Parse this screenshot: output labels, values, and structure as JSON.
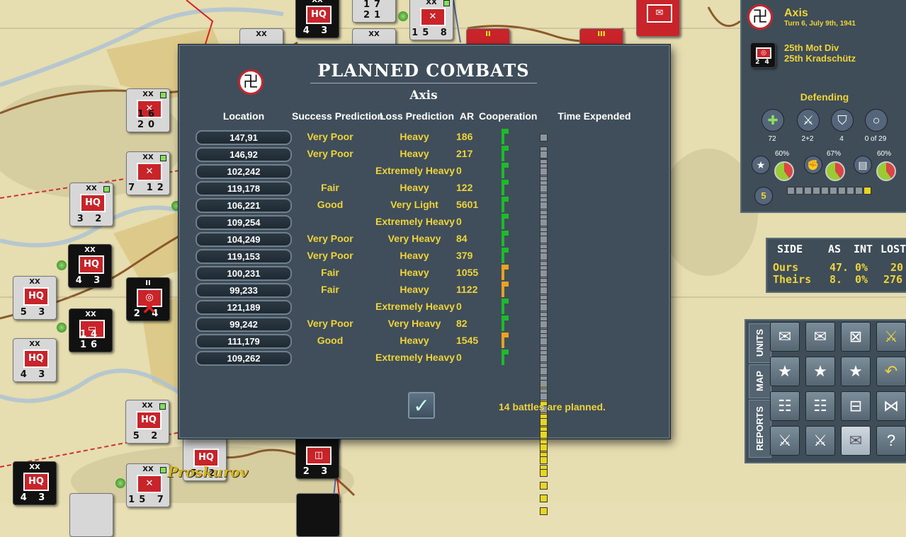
{
  "dialog": {
    "title": "PLANNED COMBATS",
    "side": "Axis",
    "columns": {
      "location": "Location",
      "success": "Success Prediction",
      "loss": "Loss Prediction",
      "ar": "AR",
      "coop": "Cooperation",
      "time": "Time Expended"
    },
    "rows": [
      {
        "loc": "147,91",
        "success": "Very Poor",
        "loss": "Heavy",
        "ar": "186",
        "coop": "green",
        "grey": 4,
        "yellow": 0
      },
      {
        "loc": "146,92",
        "success": "Very Poor",
        "loss": "Heavy",
        "ar": "217",
        "coop": "green",
        "grey": 4,
        "yellow": 0
      },
      {
        "loc": "102,242",
        "success": "",
        "loss": "Extremely Heavy",
        "ar": "0",
        "coop": "green",
        "grey": 5,
        "yellow": 1
      },
      {
        "loc": "119,178",
        "success": "Fair",
        "loss": "Heavy",
        "ar": "122",
        "coop": "green",
        "grey": 5,
        "yellow": 1
      },
      {
        "loc": "106,221",
        "success": "Good",
        "loss": "Very Light",
        "ar": "5601",
        "coop": "green",
        "grey": 5,
        "yellow": 1
      },
      {
        "loc": "109,254",
        "success": "",
        "loss": "Extremely Heavy",
        "ar": "0",
        "coop": "green",
        "grey": 5,
        "yellow": 5
      },
      {
        "loc": "104,249",
        "success": "Very Poor",
        "loss": "Very Heavy",
        "ar": "84",
        "coop": "green",
        "grey": 5,
        "yellow": 5
      },
      {
        "loc": "119,153",
        "success": "Very Poor",
        "loss": "Heavy",
        "ar": "379",
        "coop": "green",
        "grey": 5,
        "yellow": 5
      },
      {
        "loc": "100,231",
        "success": "Fair",
        "loss": "Heavy",
        "ar": "1055",
        "coop": "orange",
        "grey": 5,
        "yellow": 5
      },
      {
        "loc": "99,233",
        "success": "Fair",
        "loss": "Heavy",
        "ar": "1122",
        "coop": "orange",
        "grey": 5,
        "yellow": 5
      },
      {
        "loc": "121,189",
        "success": "",
        "loss": "Extremely Heavy",
        "ar": "0",
        "coop": "green",
        "grey": 5,
        "yellow": 6
      },
      {
        "loc": "99,242",
        "success": "Very Poor",
        "loss": "Very Heavy",
        "ar": "82",
        "coop": "green",
        "grey": 5,
        "yellow": 6
      },
      {
        "loc": "111,179",
        "success": "Good",
        "loss": "Heavy",
        "ar": "1545",
        "coop": "orange",
        "grey": 5,
        "yellow": 6
      },
      {
        "loc": "109,262",
        "success": "",
        "loss": "Extremely Heavy",
        "ar": "0",
        "coop": "green",
        "grey": 5,
        "yellow": 8
      }
    ],
    "ok_symbol": "✓",
    "planned_text": "14 battles are planned."
  },
  "info": {
    "side": "Axis",
    "turn": "Turn 6, July 9th, 1941",
    "unit_line1": "25th Mot Div",
    "unit_line2": "25th Kradschütz",
    "unit_strength": "2 4",
    "posture": "Defending",
    "stats": [
      {
        "icon": "medic-icon",
        "glyph": "✚",
        "value": "72"
      },
      {
        "icon": "swords-icon",
        "glyph": "⚔",
        "value": "2+2"
      },
      {
        "icon": "shield-icon",
        "glyph": "⛉",
        "value": "4"
      },
      {
        "icon": "ring-icon",
        "glyph": "○",
        "value": "0 of 29"
      }
    ],
    "percents": [
      "60%",
      "67%",
      "60%"
    ],
    "level": "5",
    "pips_grey": 9,
    "pips_yellow": 1
  },
  "combat_stats": {
    "headers": [
      "SIDE",
      "AS",
      "INT",
      "LOST"
    ],
    "rows": [
      [
        "Ours",
        "47.",
        "0%",
        "20"
      ],
      [
        "Theirs",
        "8.",
        "0%",
        "276"
      ]
    ]
  },
  "menu": {
    "tabs": [
      "UNITS",
      "MAP",
      "REPORTS"
    ]
  },
  "map": {
    "city1": "Proskurov"
  },
  "colors": {
    "panel": "#3e4d58",
    "yellow": "#f0d33a",
    "green": "#1dbb2a",
    "orange": "#e8a020"
  }
}
